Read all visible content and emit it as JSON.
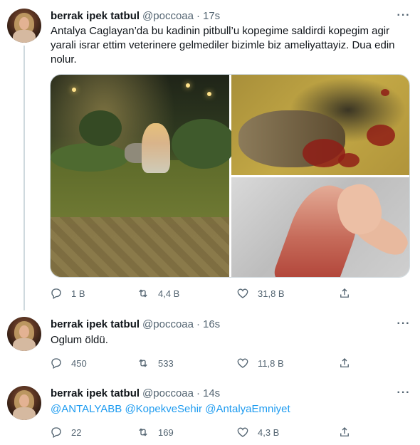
{
  "tweets": [
    {
      "author_name": "berrak ipek tatbul",
      "handle": "@poccoaa",
      "dot": "·",
      "time": "17s",
      "text": "Antalya Caglayan’da bu kadinin pitbull’u kopegime saldirdi kopegim agir yarali israr ettim veterinere gelmediler bizimle biz ameliyattayiz. Dua edin nolur.",
      "reply_count": "1 B",
      "retweet_count": "4,4 B",
      "like_count": "31,8 B"
    },
    {
      "author_name": "berrak ipek tatbul",
      "handle": "@poccoaa",
      "dot": "·",
      "time": "16s",
      "text": "Oglum öldü.",
      "reply_count": "450",
      "retweet_count": "533",
      "like_count": "11,8 B"
    },
    {
      "author_name": "berrak ipek tatbul",
      "handle": "@poccoaa",
      "dot": "·",
      "time": "14s",
      "mentions": [
        "@ANTALYABB",
        "@KopekveSehir",
        "@AntalyaEmniyet"
      ],
      "reply_count": "22",
      "retweet_count": "169",
      "like_count": "4,3 B"
    }
  ],
  "more_icon": "···",
  "colors": {
    "text": "#0f1419",
    "secondary": "#536471",
    "link": "#1d9bf0",
    "thread_line": "#cfd9de"
  },
  "icons": [
    "reply-icon",
    "retweet-icon",
    "like-icon",
    "share-icon",
    "more-icon"
  ]
}
